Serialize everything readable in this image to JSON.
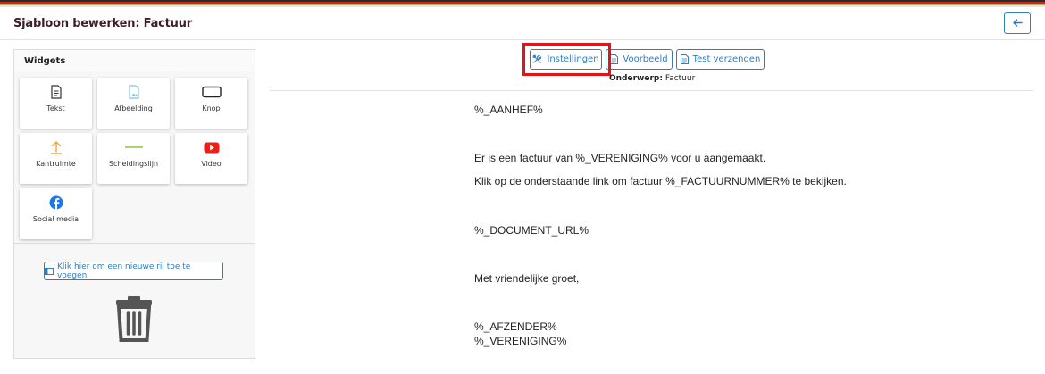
{
  "header": {
    "title": "Sjabloon bewerken: Factuur",
    "back_icon": "arrow-left-icon"
  },
  "colors": {
    "accent": "#2f7dc0",
    "title": "#3f1f2c",
    "highlight": "#e0141b",
    "flag_top": "#2b2b2b",
    "flag_mid": "#c62828",
    "flag_low": "#d8a93a"
  },
  "widgets": {
    "title": "Widgets",
    "items": [
      {
        "label": "Tekst",
        "icon": "document-icon"
      },
      {
        "label": "Afbeelding",
        "icon": "image-icon"
      },
      {
        "label": "Knop",
        "icon": "button-icon"
      },
      {
        "label": "Kantruimte",
        "icon": "upload-arrow-icon"
      },
      {
        "label": "Scheidingslijn",
        "icon": "divider-line-icon"
      },
      {
        "label": "Video",
        "icon": "youtube-icon"
      },
      {
        "label": "Social media",
        "icon": "facebook-icon"
      }
    ],
    "add_row_label": "Klik hier om een nieuwe rij toe te voegen",
    "trash_icon": "trash-icon"
  },
  "toolbar": {
    "settings_label": "Instellingen",
    "preview_label": "Voorbeeld",
    "test_send_label": "Test verzenden"
  },
  "subject": {
    "label": "Onderwerp:",
    "value": "Factuur"
  },
  "email_body": {
    "line1": "%_AANHEF%",
    "line2": "Er is een factuur  van %_VERENIGING% voor u aangemaakt.",
    "line3": "Klik op de onderstaande link om factuur %_FACTUURNUMMER% te bekijken.",
    "line4": "%_DOCUMENT_URL%",
    "line5": "Met vriendelijke groet,",
    "line6": "%_AFZENDER%",
    "line7": "%_VERENIGING%"
  }
}
